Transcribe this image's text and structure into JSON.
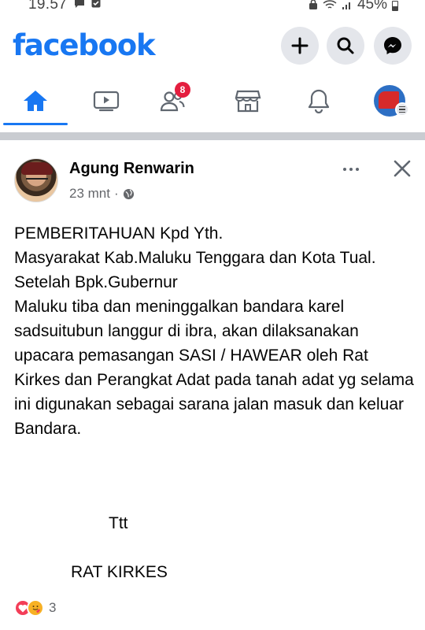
{
  "status_bar": {
    "time": "19.57",
    "battery": "45%"
  },
  "header": {
    "brand": "facebook",
    "add_icon": "plus-icon",
    "search_icon": "search-icon",
    "messenger_icon": "messenger-icon"
  },
  "tabs": [
    {
      "name": "home",
      "icon": "home-icon",
      "active": true
    },
    {
      "name": "watch",
      "icon": "video-icon"
    },
    {
      "name": "friends",
      "icon": "friends-icon",
      "badge": "8"
    },
    {
      "name": "marketplace",
      "icon": "marketplace-icon"
    },
    {
      "name": "notifications",
      "icon": "bell-icon"
    },
    {
      "name": "menu",
      "icon": "profile-menu-icon"
    }
  ],
  "colors": {
    "brand": "#1877f2",
    "badge": "#e41e3f",
    "secondary_text": "#65676b"
  },
  "post": {
    "author": "Agung Renwarin",
    "time": "23 mnt",
    "separator": "·",
    "audience_icon": "globe-icon",
    "body": "PEMBERITAHUAN Kpd Yth.\nMasyarakat Kab.Maluku Tenggara dan Kota Tual.\nSetelah Bpk.Gubernur\nMaluku tiba dan meninggalkan bandara karel sadsuitubun langgur di ibra, akan dilaksanakan upacara pemasangan SASI / HAWEAR oleh Rat Kirkes dan Perangkat Adat pada tanah adat yg selama ini digunakan sebagai sarana jalan masuk dan keluar Bandara.",
    "signature_short": "Ttt",
    "signature_name": "RAT KIRKES",
    "reaction_count": "3",
    "reactions": [
      "love-reaction-icon",
      "care-reaction-icon"
    ]
  }
}
